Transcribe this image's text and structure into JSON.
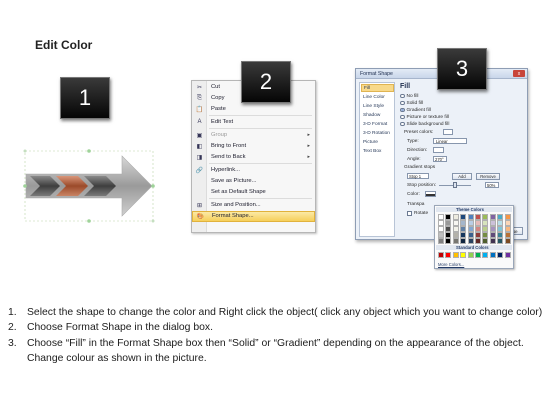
{
  "title": "Edit Color",
  "badges": [
    "1",
    "2",
    "3"
  ],
  "context_menu": {
    "items": [
      {
        "icon": "cut-icon",
        "glyph": "✂",
        "label": "Cut",
        "disabled": false,
        "submenu": false
      },
      {
        "icon": "copy-icon",
        "glyph": "⎘",
        "label": "Copy",
        "disabled": false,
        "submenu": false
      },
      {
        "icon": "paste-icon",
        "glyph": "📋",
        "label": "Paste",
        "disabled": false,
        "submenu": false
      },
      {
        "icon": "edit-text-icon",
        "glyph": "A",
        "label": "Edit Text",
        "disabled": false,
        "submenu": false
      },
      {
        "icon": "group-icon",
        "glyph": "▣",
        "label": "Group",
        "disabled": true,
        "submenu": true
      },
      {
        "icon": "bring-to-front-icon",
        "glyph": "◧",
        "label": "Bring to Front",
        "disabled": false,
        "submenu": true
      },
      {
        "icon": "send-to-back-icon",
        "glyph": "◨",
        "label": "Send to Back",
        "disabled": false,
        "submenu": true
      },
      {
        "icon": "hyperlink-icon",
        "glyph": "🔗",
        "label": "Hyperlink...",
        "disabled": false,
        "submenu": false
      },
      {
        "icon": "",
        "glyph": "",
        "label": "Save as Picture...",
        "disabled": false,
        "submenu": false
      },
      {
        "icon": "",
        "glyph": "",
        "label": "Set as Default Shape",
        "disabled": false,
        "submenu": false
      },
      {
        "icon": "size-position-icon",
        "glyph": "⊞",
        "label": "Size and Position...",
        "disabled": false,
        "submenu": false
      },
      {
        "icon": "format-shape-icon",
        "glyph": "🎨",
        "label": "Format Shape...",
        "disabled": false,
        "submenu": false,
        "highlight": true
      }
    ]
  },
  "dialog": {
    "title": "Format Shape",
    "close_x": "x",
    "nav": [
      "Fill",
      "Line Color",
      "Line Style",
      "Shadow",
      "3-D Format",
      "3-D Rotation",
      "Picture",
      "Text Box"
    ],
    "section": "Fill",
    "fill_options": [
      "No fill",
      "Solid fill",
      "Gradient fill",
      "Picture or texture fill",
      "Slide background fill"
    ],
    "preset_colors": "Preset colors:",
    "type_label": "Type:",
    "type_value": "Linear",
    "direction_label": "Direction:",
    "angle_label": "Angle:",
    "angle_value": "270°",
    "gradient_stops": "Gradient stops",
    "stop_value": "Stop 1",
    "add_button": "Add",
    "remove_button": "Remove",
    "stop_position_label": "Stop position:",
    "stop_position_value": "50%",
    "color_label": "Color:",
    "transparency_label": "Transpa",
    "rotate_label": "Rotate",
    "close_button": "Close"
  },
  "palette": {
    "theme_colors": "Theme Colors",
    "standard_colors": "Standard Colors",
    "more_colors": "More Colors...",
    "theme_top": [
      "#ffffff",
      "#000000",
      "#eeece1",
      "#1f497d",
      "#4f81bd",
      "#c0504d",
      "#9bbb59",
      "#8064a2",
      "#4bacc6",
      "#f79646"
    ],
    "standard": [
      "#c00000",
      "#ff0000",
      "#ffc000",
      "#ffff00",
      "#92d050",
      "#00b050",
      "#00b0f0",
      "#0070c0",
      "#002060",
      "#7030a0"
    ]
  },
  "instructions": [
    {
      "num": "1.",
      "text": "Select the shape to change the color and Right click the object( click any object which you want to change color)"
    },
    {
      "num": "2.",
      "text": "Choose Format Shape in the dialog box."
    },
    {
      "num": "3.",
      "text": "Choose “Fill” in the Format Shape box then “Solid” or “Gradient” depending on the appearance of the object. Change colour as shown in the picture."
    }
  ]
}
